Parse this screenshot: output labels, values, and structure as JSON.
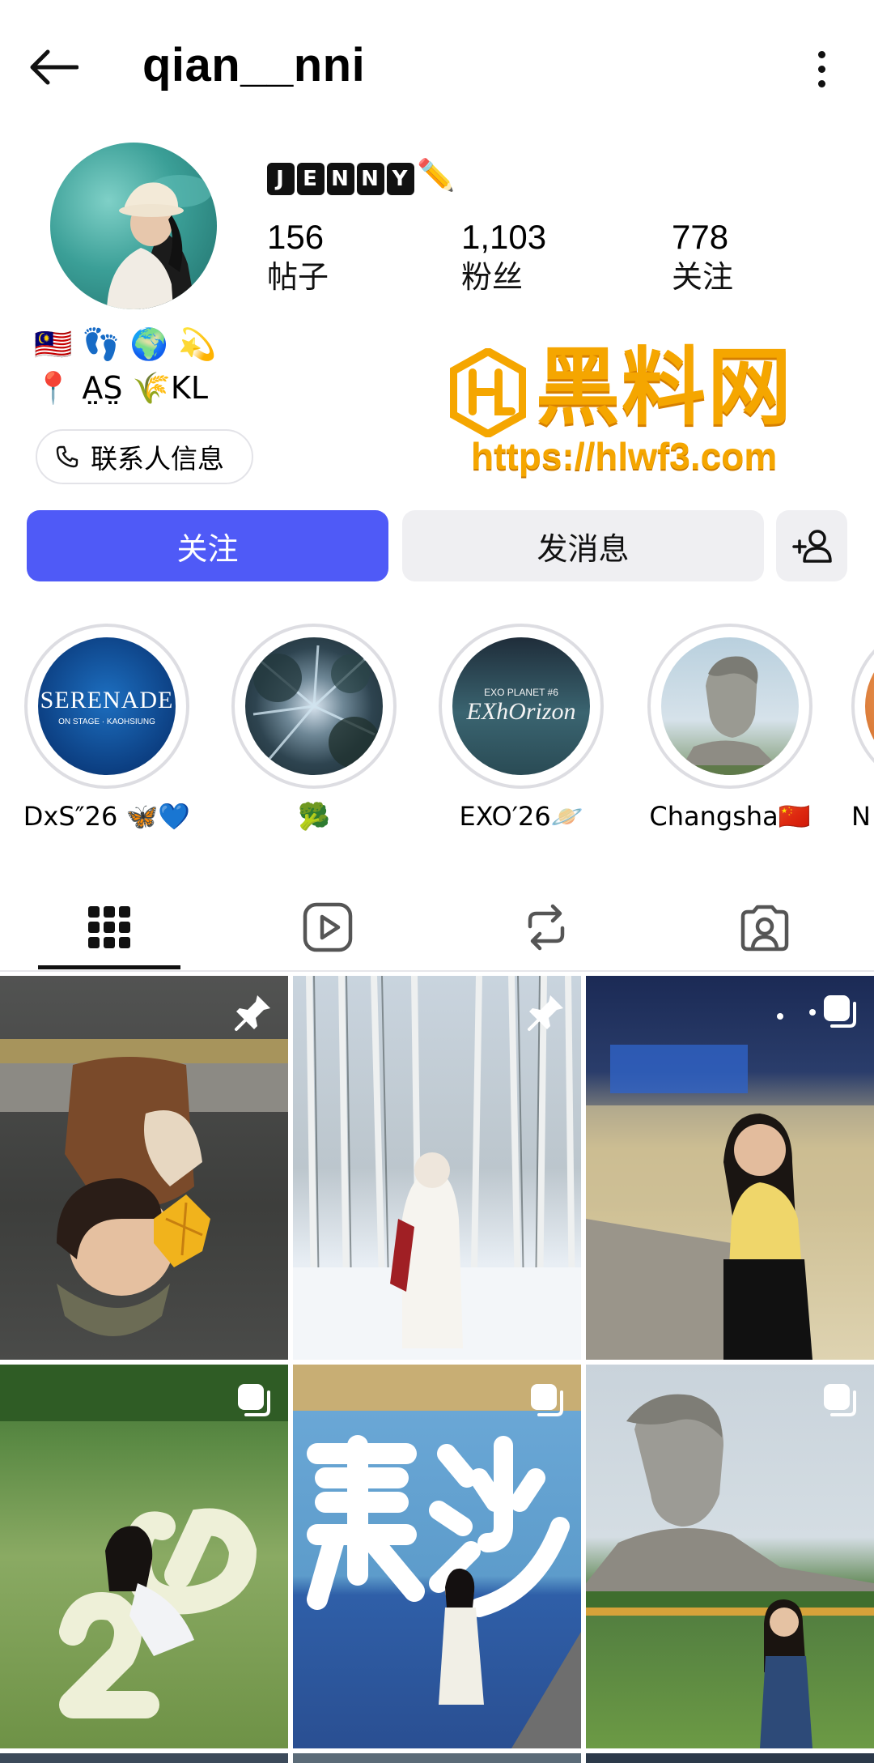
{
  "header": {
    "username": "qian__nni"
  },
  "profile": {
    "display_name_letters": [
      "J",
      "E",
      "N",
      "N",
      "Y"
    ],
    "display_name_suffix": "✏️",
    "stats": [
      {
        "value": "156",
        "label": "帖子"
      },
      {
        "value": "1,103",
        "label": "粉丝"
      },
      {
        "value": "778",
        "label": "关注"
      }
    ],
    "bio_line1": "🇲🇾 👣 🌍 💫",
    "bio_line2": "📍 A̤S̤ 🌾KL",
    "contact_label": "联系人信息"
  },
  "watermark": {
    "title": "黑料网",
    "url": "https://hlwf3.com"
  },
  "actions": {
    "follow_label": "关注",
    "message_label": "发消息"
  },
  "highlights": [
    {
      "label": "DxS″26 🦋💙",
      "cover_text": "SERENADE",
      "cover_sub": "ON STAGE · KAOHSIUNG"
    },
    {
      "label": "🥦"
    },
    {
      "label": "EXO′26🪐",
      "cover_text": "EXhOrizon",
      "cover_sub": "EXO PLANET #6"
    },
    {
      "label": "Changsha🇨🇳"
    },
    {
      "label": "N"
    }
  ],
  "tabs": [
    "posts-grid",
    "reels",
    "reposts",
    "tagged"
  ],
  "grid": {
    "badges": [
      "pin-icon",
      "pin-icon",
      "carousel-icon",
      "carousel-icon",
      "carousel-icon",
      "carousel-icon"
    ]
  },
  "colors": {
    "follow_button": "#4f5af7",
    "watermark": "#f5a600"
  }
}
